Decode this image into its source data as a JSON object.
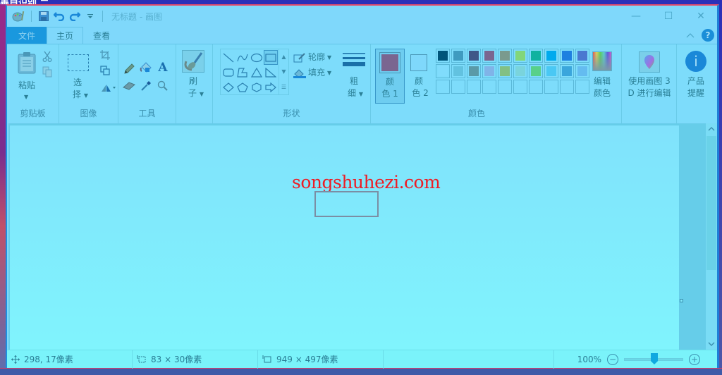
{
  "desktop": {
    "background_text": "善自识别 二"
  },
  "titlebar": {
    "title": "无标题 - 画图",
    "quick_access": [
      "save",
      "undo",
      "redo",
      "customize"
    ],
    "controls": {
      "minimize": "—",
      "maximize": "☐",
      "close": "✕"
    }
  },
  "tabs": [
    {
      "label": "文件",
      "state": "file-menu"
    },
    {
      "label": "主页",
      "state": "active"
    },
    {
      "label": "查看",
      "state": "inactive"
    }
  ],
  "ribbon": {
    "help_label": "?",
    "collapse_label": "^",
    "clipboard": {
      "label": "剪贴板",
      "paste": "粘贴"
    },
    "image": {
      "label": "图像",
      "select_1": "选",
      "select_2": "择"
    },
    "tools": {
      "label": "工具"
    },
    "brushes": {
      "label_1": "刷",
      "label_2": "子"
    },
    "shapes": {
      "label": "形状",
      "outline": "轮廓",
      "fill": "填充"
    },
    "size": {
      "label_1": "粗",
      "label_2": "细"
    },
    "colors": {
      "label": "颜色",
      "color1_label_1": "颜",
      "color1_label_2": "色 1",
      "color2_label_1": "颜",
      "color2_label_2": "色 2",
      "color1_value": "#7a6690",
      "color2_value": "#7fd8fb",
      "palette_row1": [
        "#00557a",
        "#3f9bc0",
        "#3f5888",
        "#7a6690",
        "#7a9a8e",
        "#82d67a",
        "#10b2a0",
        "#00aaee",
        "#1e80e0",
        "#4a78d0"
      ],
      "palette_row2": [
        "#80dcfc",
        "#62c2e0",
        "#5a9aa8",
        "#80b4e8",
        "#82c084",
        "#7ad4dc",
        "#58d08a",
        "#4ac8f4",
        "#3ba6dc",
        "#64bcf0"
      ],
      "edit_colors_1": "编辑",
      "edit_colors_2": "颜色"
    },
    "paint3d": {
      "label_1": "使用画图 3",
      "label_2": "D 进行编辑"
    },
    "product_alert": {
      "label_1": "产品",
      "label_2": "提醒"
    }
  },
  "canvas": {
    "watermark_text": "songshuhezi.com"
  },
  "statusbar": {
    "cursor_position": "298, 17像素",
    "selection_size": "83 × 30像素",
    "canvas_size": "949 × 497像素",
    "zoom_level": "100%",
    "zoom_fraction": 0.5
  }
}
